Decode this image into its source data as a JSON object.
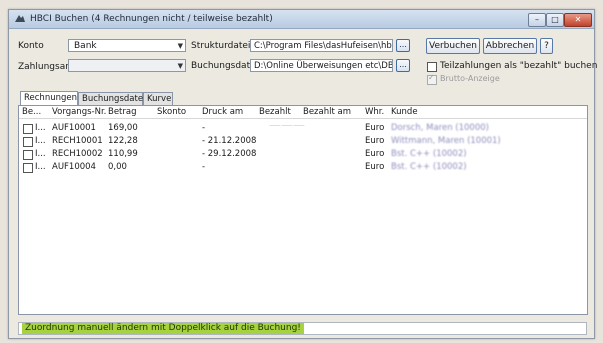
{
  "window": {
    "title": "HBCI Buchen (4 Rechnungen nicht / teilweise bezahlt)"
  },
  "titlebar_buttons": {
    "minimize": "–",
    "maximize": "□",
    "close": "✕"
  },
  "form": {
    "konto_label": "Konto",
    "konto_value": "Bank",
    "zahlungsart_label": "Zahlungsart",
    "zahlungsart_value": "",
    "strukturdatei_label": "Strukturdatei",
    "strukturdatei_value": "C:\\Program Files\\dasHufeisen\\hbciN",
    "buchungsdatei_label": "Buchungsdatei",
    "buchungsdatei_value": "D:\\Online Überweisungen etc\\DB_U:",
    "browse_label": "...",
    "verbuchen_label": "Verbuchen",
    "abbrechen_label": "Abbrechen",
    "help_label": "?",
    "teilzahlungen_label": "Teilzahlungen als \"bezahlt\" buchen",
    "brutto_label": "Brutto-Anzeige"
  },
  "tabs": [
    "Rechnungen",
    "Buchungsdatei",
    "Kurve"
  ],
  "table": {
    "columns": [
      "Be...",
      "Vorgangs-Nr.",
      "Betrag",
      "Skonto",
      "Druck am",
      "Bezahlt",
      "Bezahlt am",
      "Whr.",
      "Kunde"
    ],
    "rows": [
      {
        "be": "I...",
        "vorgang": "AUF10001",
        "betrag": "169,00",
        "skonto": "",
        "druck": "-",
        "bezahlt": "",
        "bezahlt_am": "",
        "whr": "Euro",
        "kunde": "Dorsch, Maren (10000)"
      },
      {
        "be": "I...",
        "vorgang": "RECH10001",
        "betrag": "122,28",
        "skonto": "",
        "druck": "- 21.12.2008",
        "bezahlt": "",
        "bezahlt_am": "",
        "whr": "Euro",
        "kunde": "Wittmann, Maren (10001)"
      },
      {
        "be": "I...",
        "vorgang": "RECH10002",
        "betrag": "110,99",
        "skonto": "",
        "druck": "- 29.12.2008",
        "bezahlt": "",
        "bezahlt_am": "",
        "whr": "Euro",
        "kunde": "Bst. C++ (10002)"
      },
      {
        "be": "I...",
        "vorgang": "AUF10004",
        "betrag": "0,00",
        "skonto": "",
        "druck": "-",
        "bezahlt": "",
        "bezahlt_am": "",
        "whr": "Euro",
        "kunde": "Bst. C++ (10002)"
      }
    ]
  },
  "status": {
    "message": "Zuordnung manuell ändern mit Doppelklick auf die Buchung!"
  }
}
